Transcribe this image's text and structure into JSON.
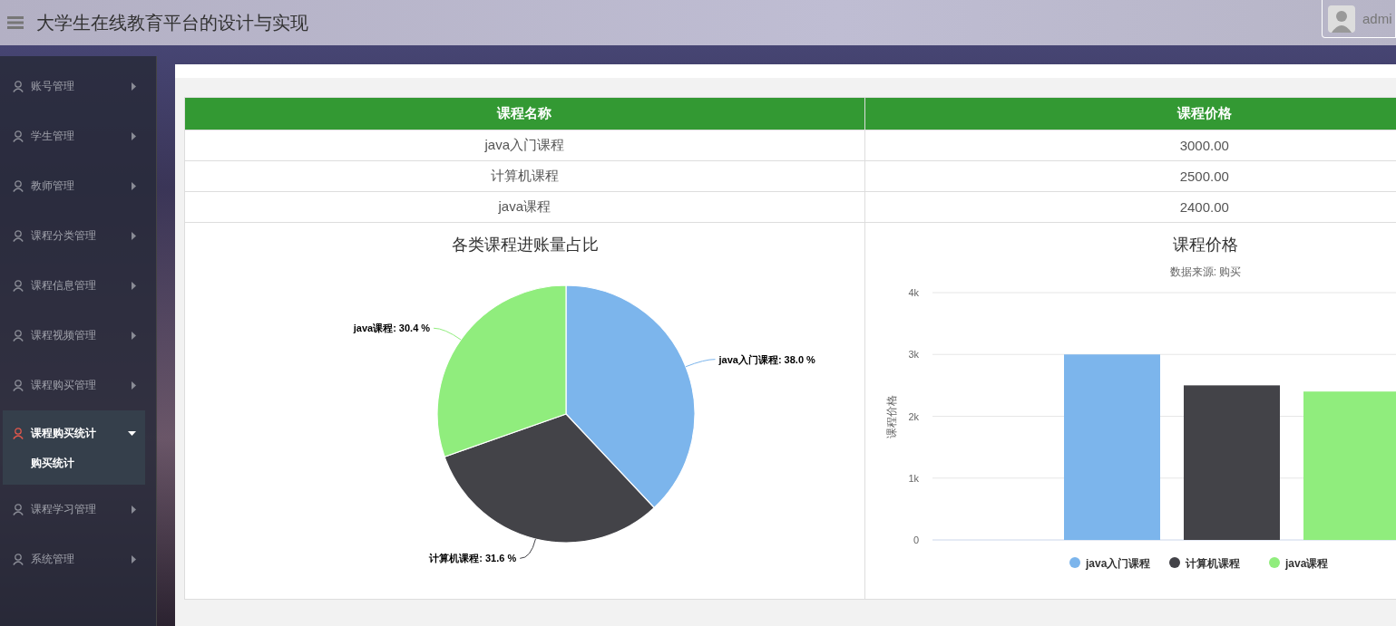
{
  "header": {
    "title": "大学生在线教育平台的设计与实现",
    "user": {
      "name": "admi"
    }
  },
  "sidebar": {
    "items": [
      {
        "label": "账号管理",
        "selected": false,
        "expanded": false
      },
      {
        "label": "学生管理",
        "selected": false,
        "expanded": false
      },
      {
        "label": "教师管理",
        "selected": false,
        "expanded": false
      },
      {
        "label": "课程分类管理",
        "selected": false,
        "expanded": false
      },
      {
        "label": "课程信息管理",
        "selected": false,
        "expanded": false
      },
      {
        "label": "课程视频管理",
        "selected": false,
        "expanded": false
      },
      {
        "label": "课程购买管理",
        "selected": false,
        "expanded": false
      },
      {
        "label": "课程购买统计",
        "selected": true,
        "expanded": true,
        "children": [
          {
            "label": "购买统计",
            "selected": true
          }
        ]
      },
      {
        "label": "课程学习管理",
        "selected": false,
        "expanded": false
      },
      {
        "label": "系统管理",
        "selected": false,
        "expanded": false
      }
    ]
  },
  "table": {
    "columns": [
      "课程名称",
      "课程价格"
    ],
    "rows": [
      [
        "java入门课程",
        "3000.00"
      ],
      [
        "计算机课程",
        "2500.00"
      ],
      [
        "java课程",
        "2400.00"
      ]
    ]
  },
  "pie_chart": {
    "chart_data": {
      "type": "pie",
      "title": "各类课程进账量占比",
      "values": [
        38.0,
        31.6,
        30.4
      ],
      "colors": [
        "#7cb5ec",
        "#434348",
        "#90ed7d"
      ],
      "value_labels": [
        "java入门课程: 38.0 %",
        "计算机课程: 31.6 %",
        "java课程: 30.4 %"
      ]
    }
  },
  "bar_chart": {
    "subtitle": "数据来源: 购买",
    "chart_data": {
      "type": "bar",
      "title": "课程价格",
      "ylabel": "课程价格",
      "ylim": [
        0,
        4000
      ],
      "grid": true,
      "legend": true,
      "yticks": [
        {
          "value": 0,
          "label": "0"
        },
        {
          "value": 1000,
          "label": "1k"
        },
        {
          "value": 2000,
          "label": "2k"
        },
        {
          "value": 3000,
          "label": "3k"
        },
        {
          "value": 4000,
          "label": "4k"
        }
      ],
      "series": [
        {
          "name": "java入门课程",
          "color": "#7cb5ec",
          "values": [
            3000
          ]
        },
        {
          "name": "计算机课程",
          "color": "#434348",
          "values": [
            2500
          ]
        },
        {
          "name": "java课程",
          "color": "#90ed7d",
          "values": [
            2400
          ]
        }
      ]
    }
  }
}
